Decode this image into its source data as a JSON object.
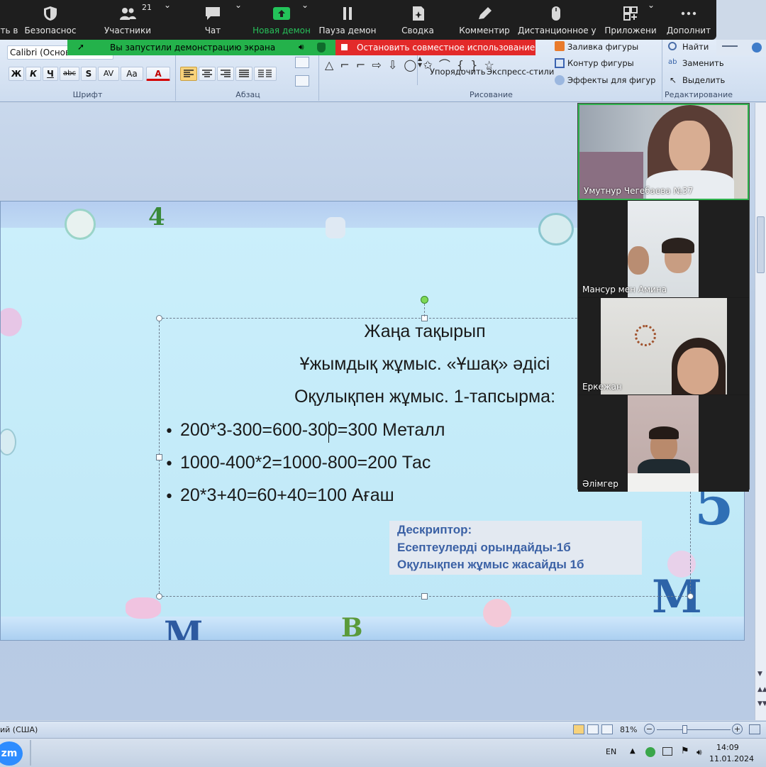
{
  "zoom": {
    "toolbar": [
      {
        "label": "ть в"
      },
      {
        "label": "Безопаснос"
      },
      {
        "label": "Участники",
        "count": "21"
      },
      {
        "label": "Чат"
      },
      {
        "label": "Новая демон"
      },
      {
        "label": "Пауза демон"
      },
      {
        "label": "Сводка"
      },
      {
        "label": "Комментир"
      },
      {
        "label": "Дистанционное у"
      },
      {
        "label": "Приложени"
      },
      {
        "label": "Дополнит"
      }
    ],
    "share_notice": "Вы запустили демонстрацию экрана",
    "stop_share": "Остановить совместное использование",
    "accent_green": "#24b24b",
    "accent_red": "#e32a2a"
  },
  "ribbon": {
    "font_name": "Calibri (Основн",
    "font_buttons": [
      "Ж",
      "К",
      "Ч",
      "abc",
      "S",
      "AV",
      "Aa",
      "A"
    ],
    "groups": {
      "font": "Шрифт",
      "paragraph": "Абзац",
      "drawing": "Рисование",
      "editing": "Редактирование"
    },
    "arrange": "Упорядочить",
    "quick_styles": "Экспресс-стили",
    "shape_fill": "Заливка фигуры",
    "shape_outline": "Контур фигуры",
    "shape_effects": "Эффекты для фигур",
    "find": "Найти",
    "replace": "Заменить",
    "select": "Выделить",
    "shape_glyphs": "△ ⌐ ⌐ ⇨ ⇩ ◯ ✩ ⌒ { } ☆"
  },
  "slide": {
    "title": "Жаңа тақырып",
    "line2": "Ұжымдық жұмыс. «Ұшақ» әдісі",
    "line3": "Оқулықпен жұмыс. 1-тапсырма:",
    "bullets": [
      "200*3-300=600-300=300   Металл",
      "1000-400*2=1000-800=200   Тас",
      "20*3+40=60+40=100   Ағаш"
    ],
    "descriptor": {
      "title": "Дескриптор:",
      "lines": [
        "Есептеулерді орындайды-1б",
        "Оқулықпен жұмыс  жасайды 1б"
      ]
    }
  },
  "participants": [
    {
      "name": "Умутнур Чегебаева №37"
    },
    {
      "name": "Мансур мен Амина"
    },
    {
      "name": "Еркежан"
    },
    {
      "name": "Әлімгер"
    }
  ],
  "status": {
    "language": "ий (США)",
    "zoom_level": "81%"
  },
  "taskbar": {
    "app": "zm",
    "lang": "EN",
    "time": "14:09",
    "date": "11.01.2024"
  }
}
